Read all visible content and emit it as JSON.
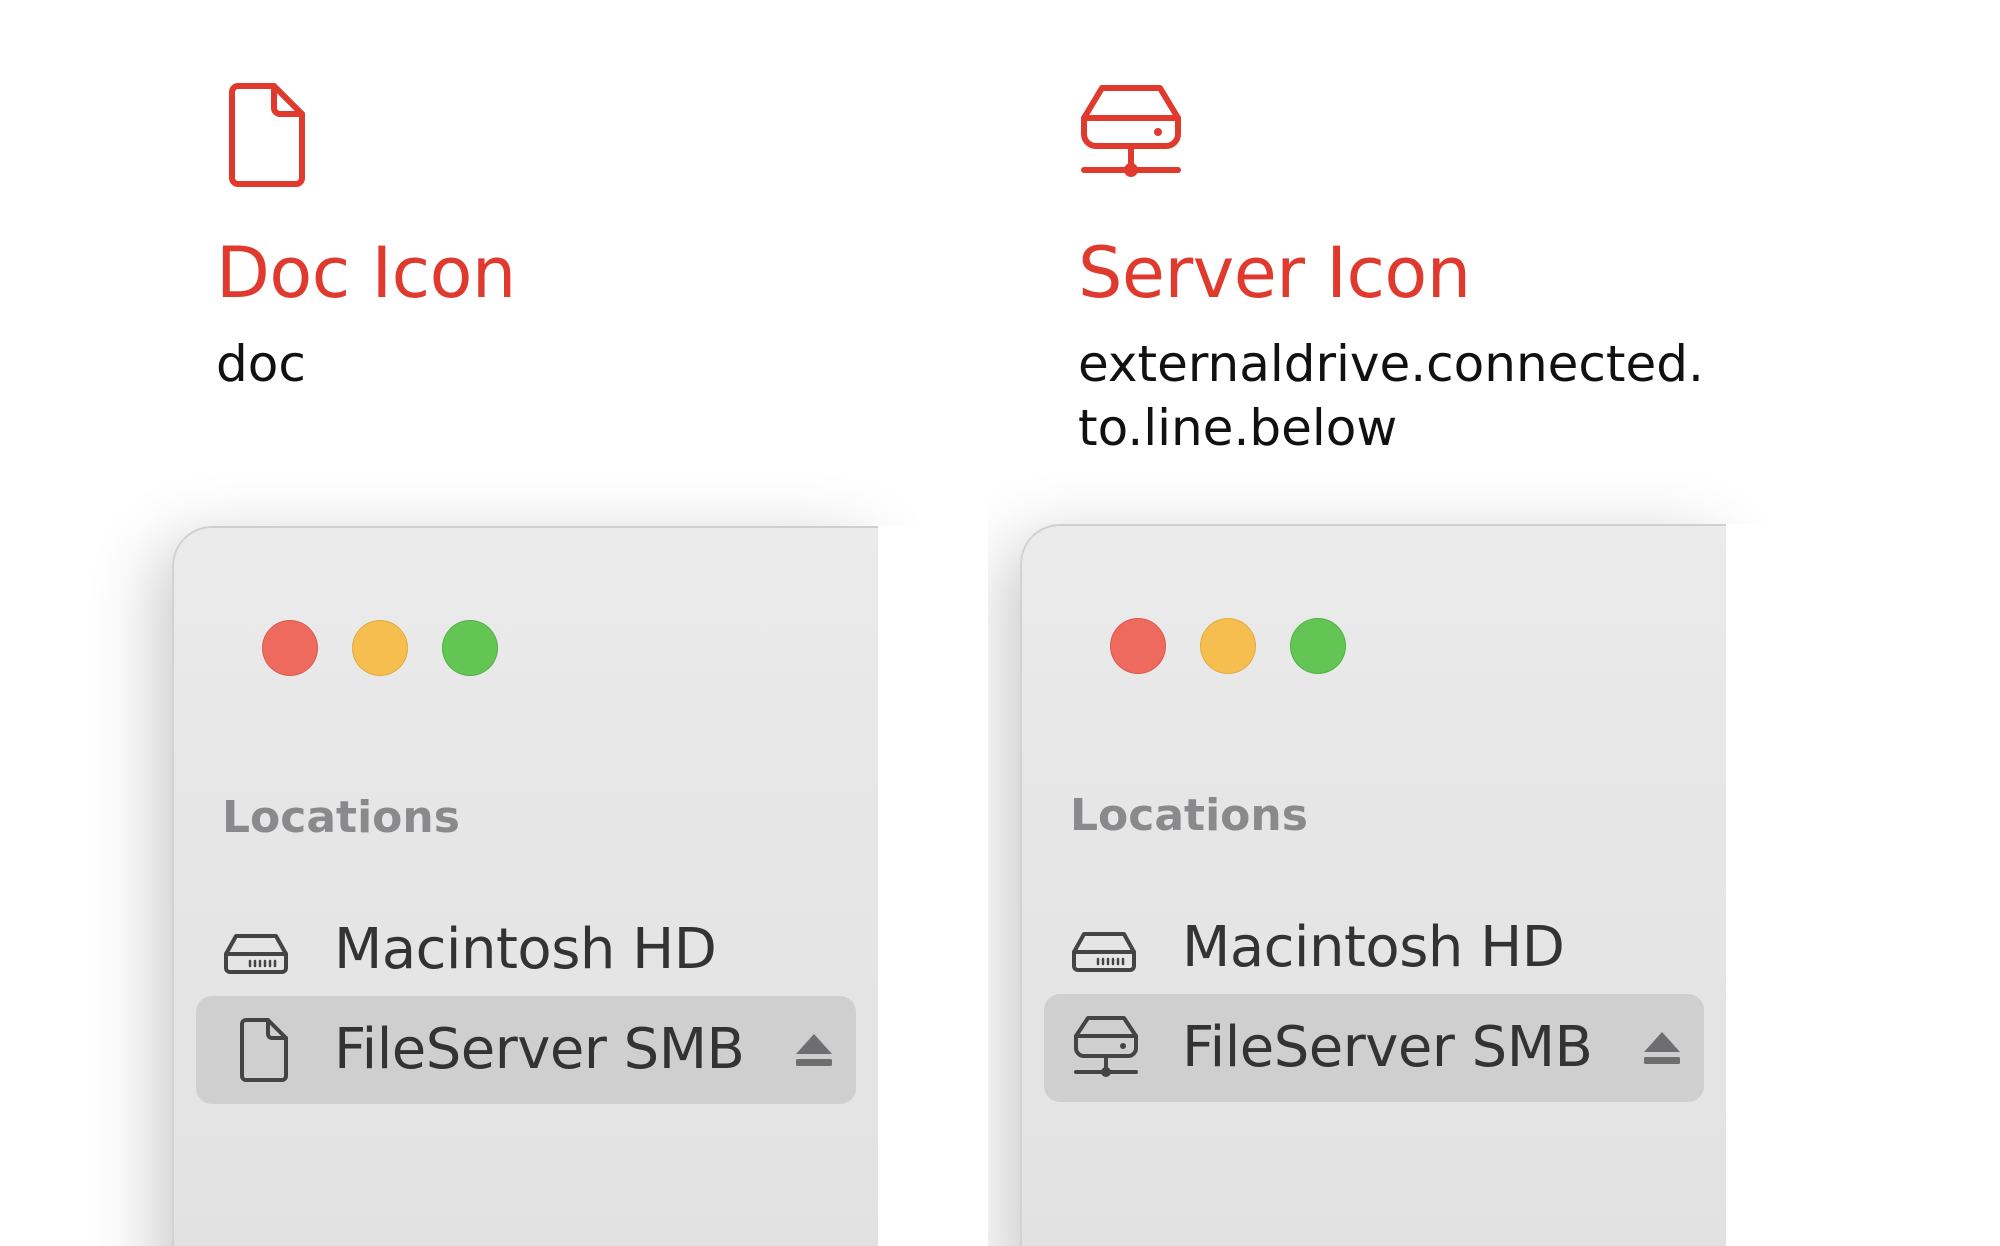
{
  "panels": [
    {
      "icon": "doc-icon",
      "title": "Doc Icon",
      "symbol_lines": [
        "doc"
      ],
      "window": {
        "section_header": "Locations",
        "items": [
          {
            "label": "Macintosh HD",
            "icon": "internal-drive-icon",
            "selected": false
          },
          {
            "label": "FileServer SMB",
            "icon": "doc-icon",
            "selected": true,
            "eject_icon": "eject-icon"
          }
        ]
      }
    },
    {
      "icon": "server-icon",
      "title": "Server Icon",
      "symbol_lines": [
        "externaldrive.connected.",
        "to.line.below"
      ],
      "window": {
        "section_header": "Locations",
        "items": [
          {
            "label": "Macintosh HD",
            "icon": "internal-drive-icon",
            "selected": false
          },
          {
            "label": "FileServer SMB",
            "icon": "server-icon",
            "selected": true,
            "eject_icon": "eject-icon"
          }
        ]
      }
    }
  ],
  "colors": {
    "accent": "#e03a2e",
    "traffic_close": "#ee6a5f",
    "traffic_minimize": "#f5be4f",
    "traffic_zoom": "#62c554",
    "selection": "#cfcfcf"
  }
}
